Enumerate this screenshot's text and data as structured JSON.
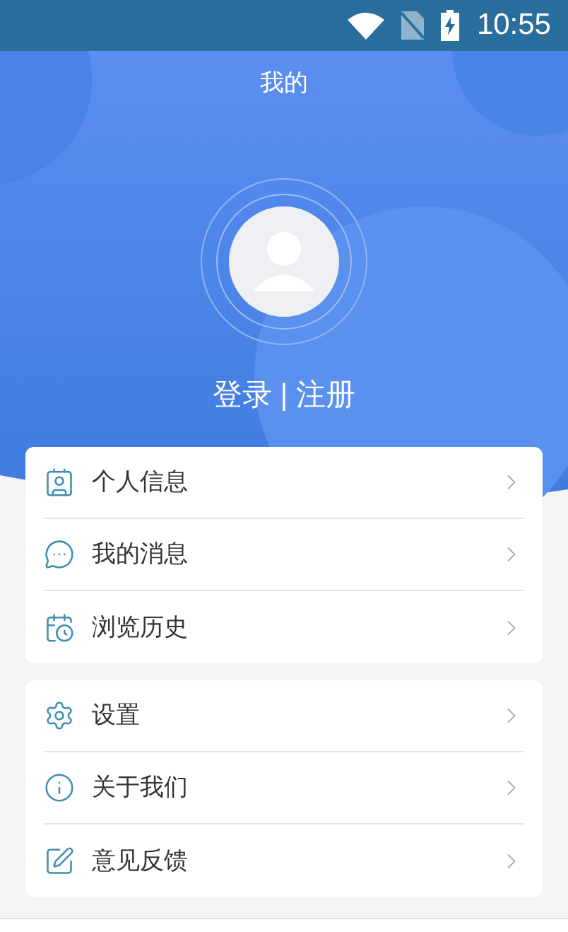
{
  "status_bar": {
    "time": "10:55"
  },
  "header": {
    "title": "我的"
  },
  "profile": {
    "login_text": "登录 | 注册"
  },
  "menu_groups": [
    {
      "items": [
        {
          "label": "个人信息",
          "kind": "profile"
        },
        {
          "label": "我的消息",
          "kind": "messages"
        },
        {
          "label": "浏览历史",
          "kind": "history"
        }
      ]
    },
    {
      "items": [
        {
          "label": "设置",
          "kind": "settings"
        },
        {
          "label": "关于我们",
          "kind": "about"
        },
        {
          "label": "意见反馈",
          "kind": "feedback"
        }
      ]
    }
  ]
}
